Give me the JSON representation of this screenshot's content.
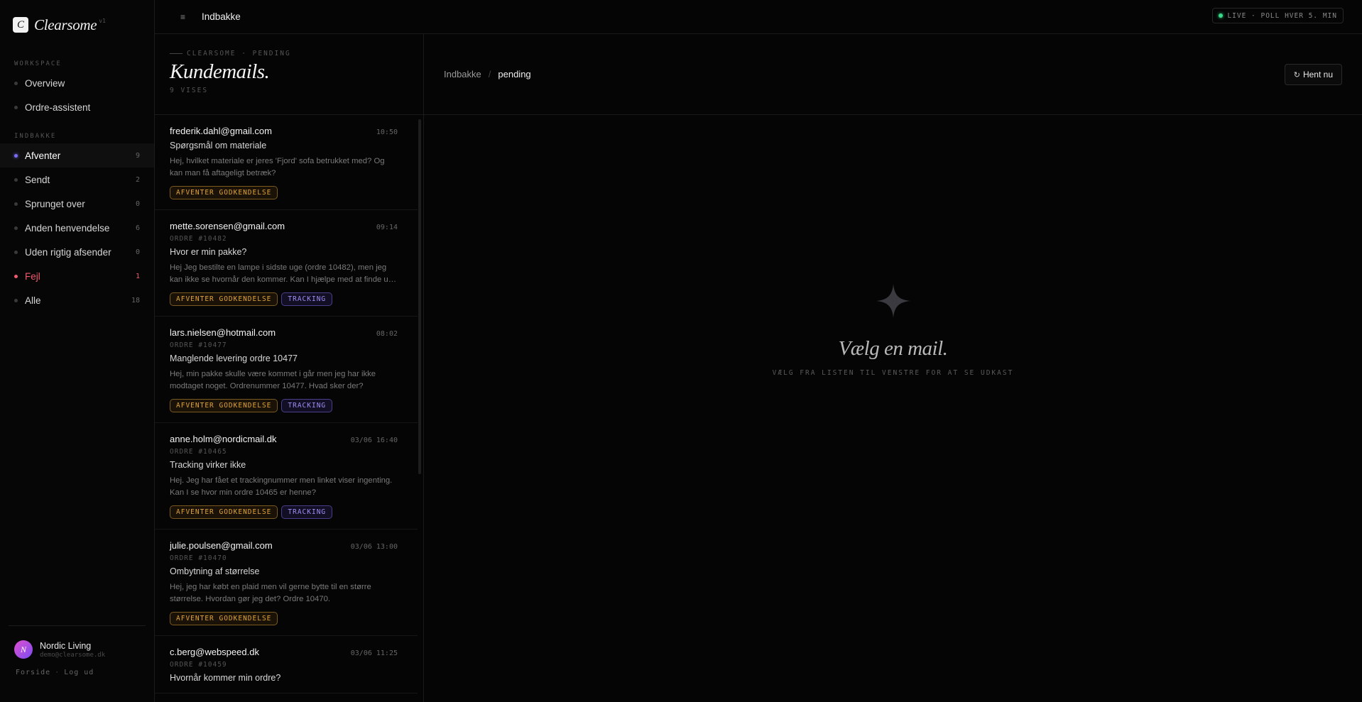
{
  "brand": {
    "logo_letter": "C",
    "name": "Clearsome",
    "version": "v1"
  },
  "sidebar": {
    "workspace_label": "WORKSPACE",
    "workspace_items": [
      {
        "label": "Overview"
      },
      {
        "label": "Ordre-assistent"
      }
    ],
    "inbox_label": "INDBAKKE",
    "inbox_items": [
      {
        "label": "Afventer",
        "count": "9",
        "state": "active"
      },
      {
        "label": "Sendt",
        "count": "2",
        "state": ""
      },
      {
        "label": "Sprunget over",
        "count": "0",
        "state": ""
      },
      {
        "label": "Anden henvendelse",
        "count": "6",
        "state": ""
      },
      {
        "label": "Uden rigtig afsender",
        "count": "0",
        "state": ""
      },
      {
        "label": "Fejl",
        "count": "1",
        "state": "error"
      },
      {
        "label": "Alle",
        "count": "18",
        "state": ""
      }
    ],
    "user": {
      "initial": "N",
      "name": "Nordic Living",
      "email": "demo@clearsome.dk"
    },
    "footer": {
      "home": "Forside",
      "separator": "·",
      "logout": "Log ud"
    }
  },
  "topbar": {
    "menu_icon": "≡",
    "title": "Indbakke",
    "live_badge": "LIVE · POLL HVER 5. MIN"
  },
  "list": {
    "eyebrow": "CLEARSOME · PENDING",
    "title": "Kundemails.",
    "count_text": "9 VISES",
    "mails": [
      {
        "from": "frederik.dahl@gmail.com",
        "time": "10:50",
        "order": "",
        "subject": "Spørgsmål om materiale",
        "preview": "Hej, hvilket materiale er jeres 'Fjord' sofa betrukket med? Og kan man få aftageligt betræk?",
        "tags": [
          "AFVENTER GODKENDELSE"
        ]
      },
      {
        "from": "mette.sorensen@gmail.com",
        "time": "09:14",
        "order": "ORDRE #10482",
        "subject": "Hvor er min pakke?",
        "preview": "Hej Jeg bestilte en lampe i sidste uge (ordre 10482), men jeg kan ikke se hvornår den kommer. Kan I hjælpe med at finde ud af det?",
        "tags": [
          "AFVENTER GODKENDELSE",
          "TRACKING"
        ]
      },
      {
        "from": "lars.nielsen@hotmail.com",
        "time": "08:02",
        "order": "ORDRE #10477",
        "subject": "Manglende levering ordre 10477",
        "preview": "Hej, min pakke skulle være kommet i går men jeg har ikke modtaget noget. Ordrenummer 10477. Hvad sker der?",
        "tags": [
          "AFVENTER GODKENDELSE",
          "TRACKING"
        ]
      },
      {
        "from": "anne.holm@nordicmail.dk",
        "time": "03/06 16:40",
        "order": "ORDRE #10465",
        "subject": "Tracking virker ikke",
        "preview": "Hej. Jeg har fået et trackingnummer men linket viser ingenting. Kan I se hvor min ordre 10465 er henne?",
        "tags": [
          "AFVENTER GODKENDELSE",
          "TRACKING"
        ]
      },
      {
        "from": "julie.poulsen@gmail.com",
        "time": "03/06 13:00",
        "order": "ORDRE #10470",
        "subject": "Ombytning af størrelse",
        "preview": "Hej, jeg har købt en plaid men vil gerne bytte til en større størrelse. Hvordan gør jeg det? Ordre 10470.",
        "tags": [
          "AFVENTER GODKENDELSE"
        ]
      },
      {
        "from": "c.berg@webspeed.dk",
        "time": "03/06 11:25",
        "order": "ORDRE #10459",
        "subject": "Hvornår kommer min ordre?",
        "preview": "",
        "tags": []
      }
    ]
  },
  "detail": {
    "breadcrumb_root": "Indbakke",
    "breadcrumb_sep": "/",
    "breadcrumb_current": "pending",
    "fetch_button": "Hent nu",
    "empty_title": "Vælg en mail.",
    "empty_subtitle": "VÆLG FRA LISTEN TIL VENSTRE FOR AT SE UDKAST"
  },
  "colors": {
    "accent": "#7b6cf6",
    "error": "#f05a6e",
    "pending": "#e0a33a",
    "tracking": "#9d8ef5",
    "live": "#39d98a"
  }
}
